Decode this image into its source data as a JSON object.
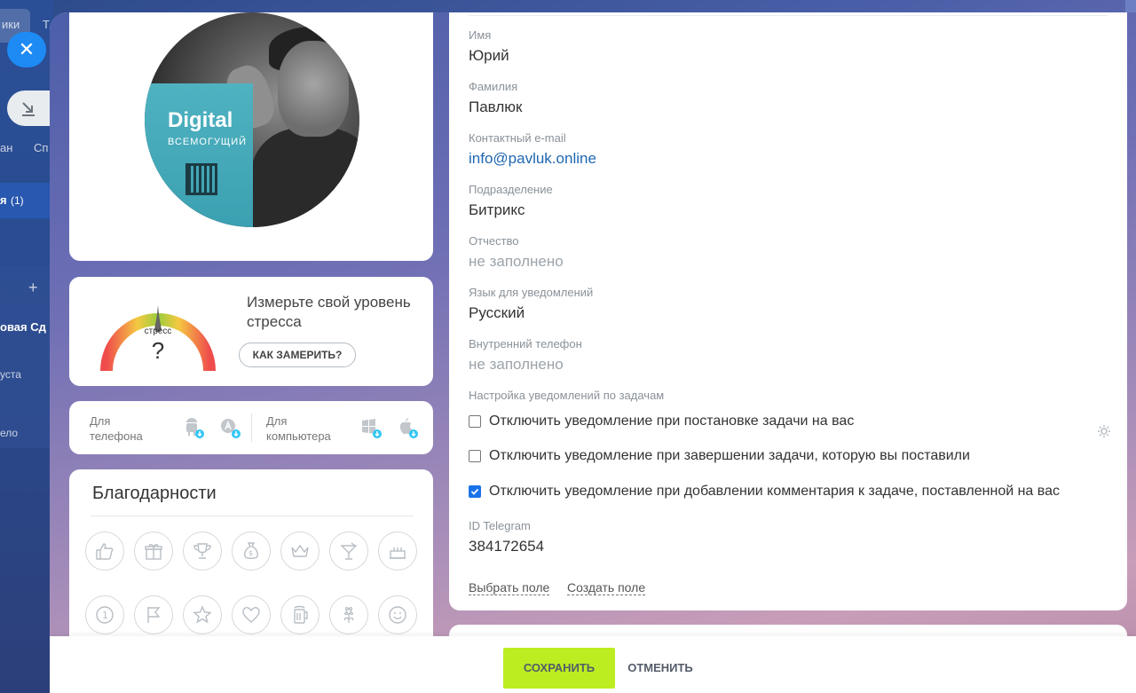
{
  "background": {
    "fragments": [
      "ики",
      "Т",
      "ан",
      "Сп",
      "я",
      "(1)",
      "+",
      "овая Сд",
      "уста",
      "ело"
    ]
  },
  "avatar": {
    "book_title": "Digital",
    "book_subtitle": "ВСЕМОГУЩИЙ"
  },
  "stress": {
    "gauge_label": "стресс",
    "value": "?",
    "text": "Измерьте свой уровень стресса",
    "button_label": "КАК ЗАМЕРИТЬ?"
  },
  "apps": {
    "phone_label": "Для телефона",
    "computer_label": "Для компьютера"
  },
  "thanks": {
    "title": "Благодарности",
    "badges": [
      "like-icon",
      "gift-icon",
      "trophy-icon",
      "money-bag-icon",
      "crown-icon",
      "cocktail-icon",
      "cake-icon",
      "number-one-icon",
      "flag-icon",
      "star-icon",
      "heart-icon",
      "beer-icon",
      "flower-icon",
      "smile-icon"
    ]
  },
  "fields": {
    "name": {
      "label": "Имя",
      "value": "Юрий"
    },
    "surname": {
      "label": "Фамилия",
      "value": "Павлюк"
    },
    "email": {
      "label": "Контактный e-mail",
      "value": "info@pavluk.online"
    },
    "department": {
      "label": "Подразделение",
      "value": "Битрикс"
    },
    "patronymic": {
      "label": "Отчество",
      "value": "не заполнено"
    },
    "language": {
      "label": "Язык для уведомлений",
      "value": "Русский"
    },
    "internal_phone": {
      "label": "Внутренний телефон",
      "value": "не заполнено"
    },
    "task_notifications": {
      "label": "Настройка уведомлений по задачам",
      "options": [
        {
          "label": "Отключить уведомление при постановке задачи на вас",
          "checked": false
        },
        {
          "label": "Отключить уведомление при завершении задачи, которую вы поставили",
          "checked": false
        },
        {
          "label": "Отключить уведомление при добавлении комментария к задаче, поставленной на вас",
          "checked": true
        }
      ]
    },
    "telegram": {
      "label": "ID Telegram",
      "value": "384172654"
    },
    "select_field_link": "Выбрать поле",
    "create_field_link": "Создать поле"
  },
  "footer": {
    "save_label": "СОХРАНИТЬ",
    "cancel_label": "ОТМЕНИТЬ"
  },
  "colors": {
    "accent_blue": "#1e8bf5",
    "save_green": "#bbed21",
    "link_blue": "#2067b0",
    "checkbox_blue": "#1a73e8"
  }
}
